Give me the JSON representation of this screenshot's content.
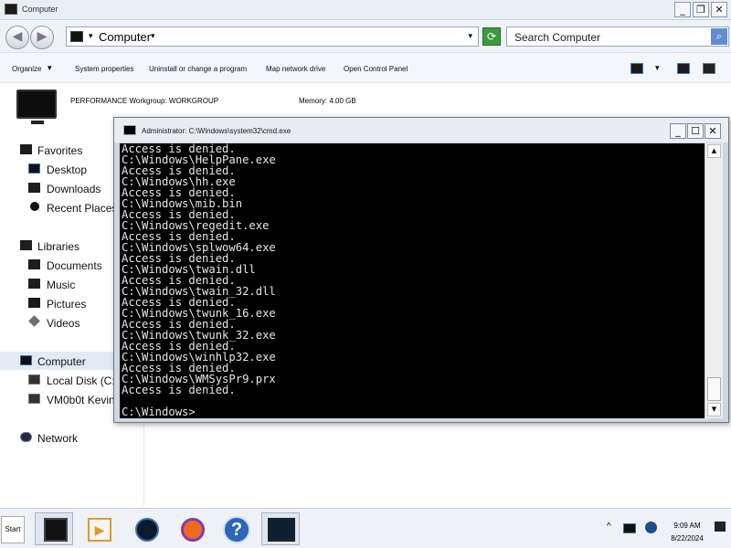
{
  "window": {
    "title": "Computer",
    "min": "_",
    "max": "❐",
    "close": "✕"
  },
  "address": {
    "crumb": "Computer",
    "caret": "▾",
    "dropdown": "▾",
    "search_placeholder": "Search Computer"
  },
  "toolbar": {
    "organize": "Organize",
    "system_properties": "System properties",
    "uninstall": "Uninstall or change a program",
    "map_drive": "Map network drive",
    "control_panel": "Open Control Panel"
  },
  "details": {
    "name": "PERFORMANCE",
    "workgroup": "Workgroup: WORKGROUP",
    "memory": "Memory: 4.00 GB"
  },
  "sidebar": {
    "favorites": "Favorites",
    "desktop": "Desktop",
    "downloads": "Downloads",
    "recent": "Recent Places",
    "libraries": "Libraries",
    "documents": "Documents",
    "music": "Music",
    "pictures": "Pictures",
    "videos": "Videos",
    "computer": "Computer",
    "local_disk": "Local Disk (C:",
    "vm_drive": "VM0b0t Kevin",
    "network": "Network"
  },
  "cmd": {
    "title": "Administrator: C:\\Windows\\system32\\cmd.exe",
    "lines": [
      "Access is denied.",
      "C:\\Windows\\HelpPane.exe",
      "Access is denied.",
      "C:\\Windows\\hh.exe",
      "Access is denied.",
      "C:\\Windows\\mib.bin",
      "Access is denied.",
      "C:\\Windows\\regedit.exe",
      "Access is denied.",
      "C:\\Windows\\splwow64.exe",
      "Access is denied.",
      "C:\\Windows\\twain.dll",
      "Access is denied.",
      "C:\\Windows\\twain_32.dll",
      "Access is denied.",
      "C:\\Windows\\twunk_16.exe",
      "Access is denied.",
      "C:\\Windows\\twunk_32.exe",
      "Access is denied.",
      "C:\\Windows\\winhlp32.exe",
      "Access is denied.",
      "C:\\Windows\\WMSysPr9.prx",
      "Access is denied.",
      "",
      "C:\\Windows>"
    ]
  },
  "taskbar": {
    "start": "Start",
    "time": "9:09 AM",
    "date": "8/22/2024",
    "help_glyph": "?",
    "tray_chevron": "^"
  }
}
